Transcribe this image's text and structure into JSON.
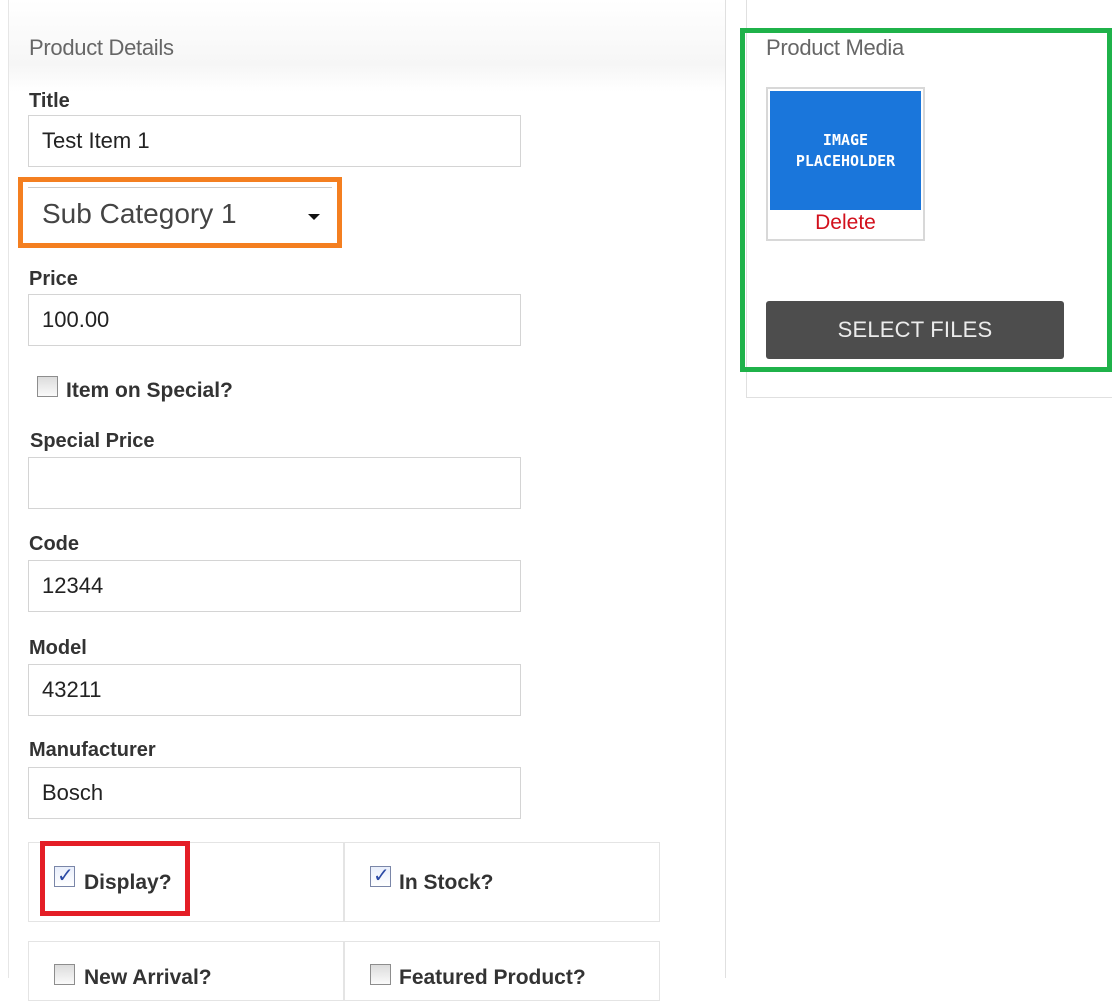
{
  "product_details": {
    "title": "Product Details",
    "title_label": "Title",
    "title_value": "Test Item 1",
    "category_value": "Sub Category 1",
    "price_label": "Price",
    "price_value": "100.00",
    "on_special_label": "Item on Special?",
    "on_special_checked": false,
    "special_price_label": "Special Price",
    "special_price_value": "",
    "code_label": "Code",
    "code_value": "12344",
    "model_label": "Model",
    "model_value": "43211",
    "manufacturer_label": "Manufacturer",
    "manufacturer_value": "Bosch",
    "display_label": "Display?",
    "display_checked": true,
    "in_stock_label": "In Stock?",
    "in_stock_checked": true,
    "new_arrival_label": "New Arrival?",
    "new_arrival_checked": false,
    "featured_label": "Featured Product?",
    "featured_checked": false
  },
  "product_media": {
    "title": "Product Media",
    "image_placeholder_text": "IMAGE PLACEHOLDER",
    "delete_label": "Delete",
    "select_files_label": "SELECT FILES"
  },
  "colors": {
    "highlight_orange": "#f47f20",
    "highlight_green": "#1fb24a",
    "highlight_red": "#e41e26",
    "placeholder_blue": "#1a76db",
    "delete_red": "#d2101c",
    "button_dark": "#4d4d4d"
  }
}
